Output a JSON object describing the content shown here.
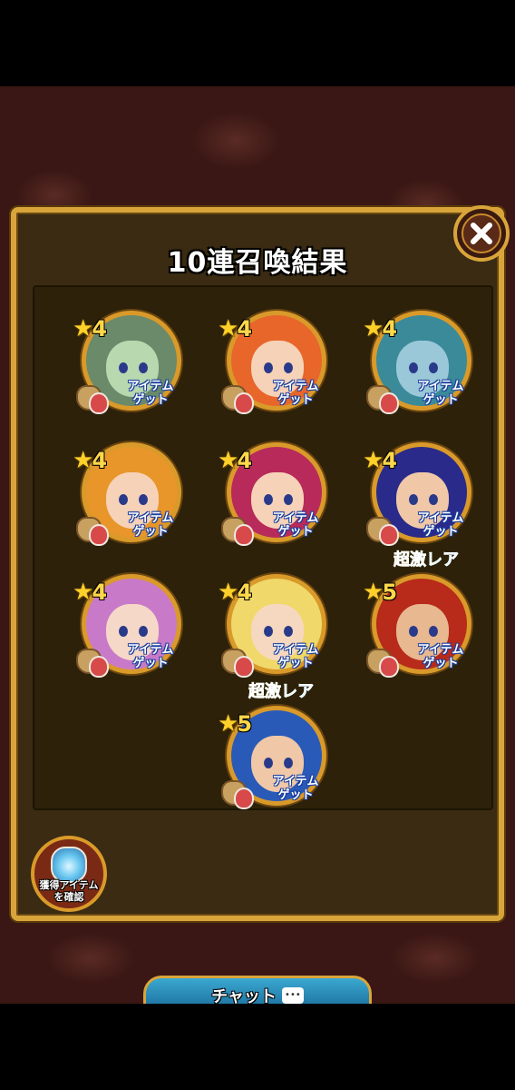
{
  "dialog": {
    "title": "10連召喚結果",
    "close_icon": "close-icon"
  },
  "results": [
    {
      "rarity": "4",
      "item_line1": "アイテム",
      "item_line2": "ゲット",
      "super_rare": "",
      "hair_color": "#6a8a6a",
      "face_color": "#b8d8b0"
    },
    {
      "rarity": "4",
      "item_line1": "アイテム",
      "item_line2": "ゲット",
      "super_rare": "",
      "hair_color": "#e8662a",
      "face_color": "#f6d2b8"
    },
    {
      "rarity": "4",
      "item_line1": "アイテム",
      "item_line2": "ゲット",
      "super_rare": "",
      "hair_color": "#3a8a9a",
      "face_color": "#9ac8d8"
    },
    {
      "rarity": "4",
      "item_line1": "アイテム",
      "item_line2": "ゲット",
      "super_rare": "",
      "hair_color": "#e8962a",
      "face_color": "#f6d2b8"
    },
    {
      "rarity": "4",
      "item_line1": "アイテム",
      "item_line2": "ゲット",
      "super_rare": "",
      "hair_color": "#b82a5a",
      "face_color": "#f6d2b8"
    },
    {
      "rarity": "4",
      "item_line1": "アイテム",
      "item_line2": "ゲット",
      "super_rare": "",
      "hair_color": "#2a2a8a",
      "face_color": "#f0c8a8"
    },
    {
      "rarity": "4",
      "item_line1": "アイテム",
      "item_line2": "ゲット",
      "super_rare": "",
      "hair_color": "#c87ac8",
      "face_color": "#f6d8c8"
    },
    {
      "rarity": "4",
      "item_line1": "アイテム",
      "item_line2": "ゲット",
      "super_rare": "",
      "hair_color": "#f0d86a",
      "face_color": "#f6d8c0"
    },
    {
      "rarity": "5",
      "item_line1": "アイテム",
      "item_line2": "ゲット",
      "super_rare": "超激レア",
      "hair_color": "#b82a1a",
      "face_color": "#e8b890"
    },
    {
      "rarity": "5",
      "item_line1": "アイテム",
      "item_line2": "ゲット",
      "super_rare": "超激レア",
      "hair_color": "#2a5ab8",
      "face_color": "#f0c8a8"
    }
  ],
  "items_check": {
    "line1": "獲得アイテム",
    "line2": "を確認"
  },
  "chat": {
    "label": "チャット",
    "icon_text": "•••"
  }
}
